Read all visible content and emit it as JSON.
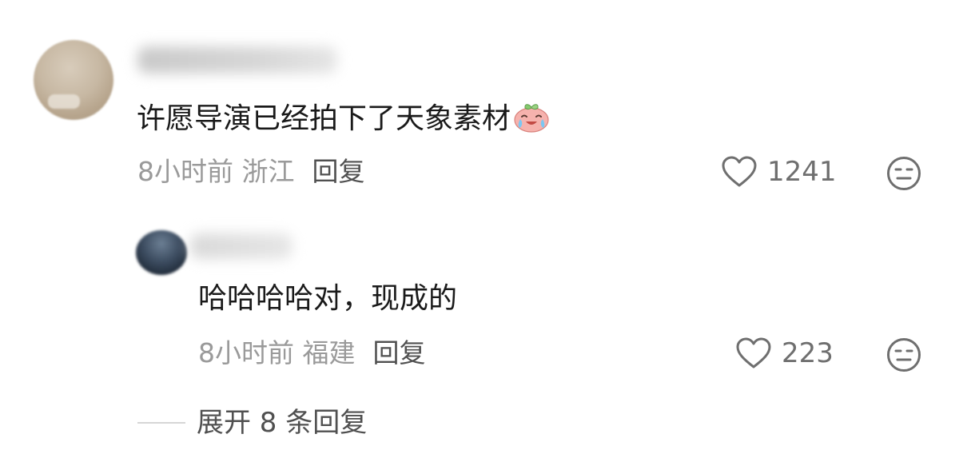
{
  "comment": {
    "text": "许愿导演已经拍下了天象素材",
    "emoji": "crying-laughing-peach-emoji",
    "time": "8小时前",
    "location": "浙江",
    "reply_label": "回复",
    "like_count": "1241"
  },
  "reply": {
    "text": "哈哈哈哈对，现成的",
    "time": "8小时前",
    "location": "福建",
    "reply_label": "回复",
    "like_count": "223"
  },
  "expand": {
    "label": "展开 8 条回复"
  },
  "colors": {
    "text": "#1a1a1a",
    "meta": "#9a9a9a",
    "action": "#505050",
    "icon": "#6f6f6f"
  }
}
